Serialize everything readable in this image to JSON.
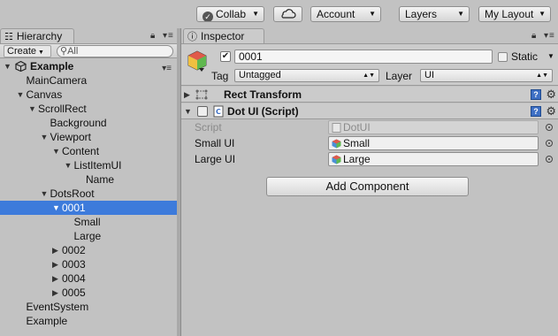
{
  "toolbar": {
    "collab_label": "Collab",
    "account_label": "Account",
    "layers_label": "Layers",
    "layout_label": "My Layout"
  },
  "hierarchy": {
    "tab_label": "Hierarchy",
    "create_label": "Create",
    "search_placeholder": "All",
    "root": "Example",
    "items": [
      {
        "label": "MainCamera",
        "depth": 1,
        "arrow": ""
      },
      {
        "label": "Canvas",
        "depth": 1,
        "arrow": "▼"
      },
      {
        "label": "ScrollRect",
        "depth": 2,
        "arrow": "▼"
      },
      {
        "label": "Background",
        "depth": 3,
        "arrow": ""
      },
      {
        "label": "Viewport",
        "depth": 3,
        "arrow": "▼"
      },
      {
        "label": "Content",
        "depth": 4,
        "arrow": "▼"
      },
      {
        "label": "ListItemUI",
        "depth": 5,
        "arrow": "▼"
      },
      {
        "label": "Name",
        "depth": 6,
        "arrow": ""
      },
      {
        "label": "DotsRoot",
        "depth": 3,
        "arrow": "▼"
      },
      {
        "label": "0001",
        "depth": 4,
        "arrow": "▼",
        "selected": true
      },
      {
        "label": "Small",
        "depth": 5,
        "arrow": ""
      },
      {
        "label": "Large",
        "depth": 5,
        "arrow": ""
      },
      {
        "label": "0002",
        "depth": 4,
        "arrow": "▶"
      },
      {
        "label": "0003",
        "depth": 4,
        "arrow": "▶"
      },
      {
        "label": "0004",
        "depth": 4,
        "arrow": "▶"
      },
      {
        "label": "0005",
        "depth": 4,
        "arrow": "▶"
      },
      {
        "label": "EventSystem",
        "depth": 1,
        "arrow": ""
      },
      {
        "label": "Example",
        "depth": 1,
        "arrow": ""
      }
    ]
  },
  "inspector": {
    "tab_label": "Inspector",
    "object_name": "0001",
    "static_label": "Static",
    "tag_label": "Tag",
    "tag_value": "Untagged",
    "layer_label": "Layer",
    "layer_value": "UI",
    "components": [
      {
        "title": "Rect Transform",
        "expanded": false
      },
      {
        "title": "Dot UI (Script)",
        "expanded": true
      }
    ],
    "properties": [
      {
        "label": "Script",
        "value": "DotUI",
        "disabled": true
      },
      {
        "label": "Small UI",
        "value": "Small",
        "disabled": false
      },
      {
        "label": "Large UI",
        "value": "Large",
        "disabled": false
      }
    ],
    "add_component_label": "Add Component"
  },
  "colors": {
    "selection": "#3d7bdb",
    "panel_bg": "#c2c2c2",
    "help_icon": "#3d6fc4"
  }
}
